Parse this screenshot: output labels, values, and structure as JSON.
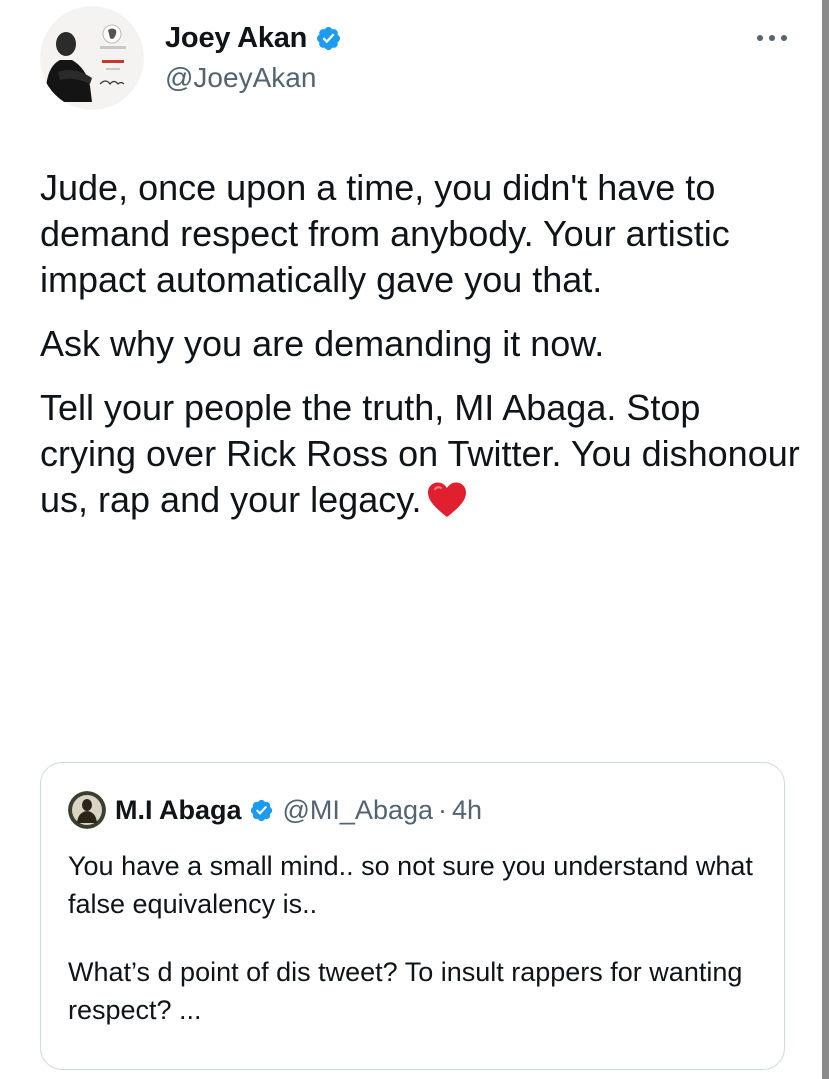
{
  "author": {
    "display_name": "Joey Akan",
    "handle": "@JoeyAkan",
    "avatar_lettering": [
      "PODCAST",
      "Joey Akan"
    ]
  },
  "menu": {
    "icon": "more-dots-icon"
  },
  "tweet": {
    "paragraphs": [
      "Jude, once upon a time, you didn't have to demand respect from anybody. Your artistic impact automatically gave you that.",
      "Ask why you are demanding it now.",
      "Tell your people the truth, MI Abaga. Stop crying over Rick Ross on Twitter. You dishonour us, rap and your legacy."
    ],
    "trailing_emoji": "red-heart-icon"
  },
  "quoted_tweet": {
    "display_name": "M.I Abaga",
    "handle": "@MI_Abaga",
    "separator": "·",
    "time": "4h",
    "paragraphs": [
      "You have a small mind.. so not sure you understand what false equivalency is..",
      "What’s d point of dis tweet? To insult rappers for wanting respect? ..."
    ]
  },
  "colors": {
    "text_primary": "#0f1419",
    "text_secondary": "#536471",
    "verified_blue": "#1d9bf0",
    "border": "#cfd9de",
    "heart_red": "#e0202e"
  }
}
